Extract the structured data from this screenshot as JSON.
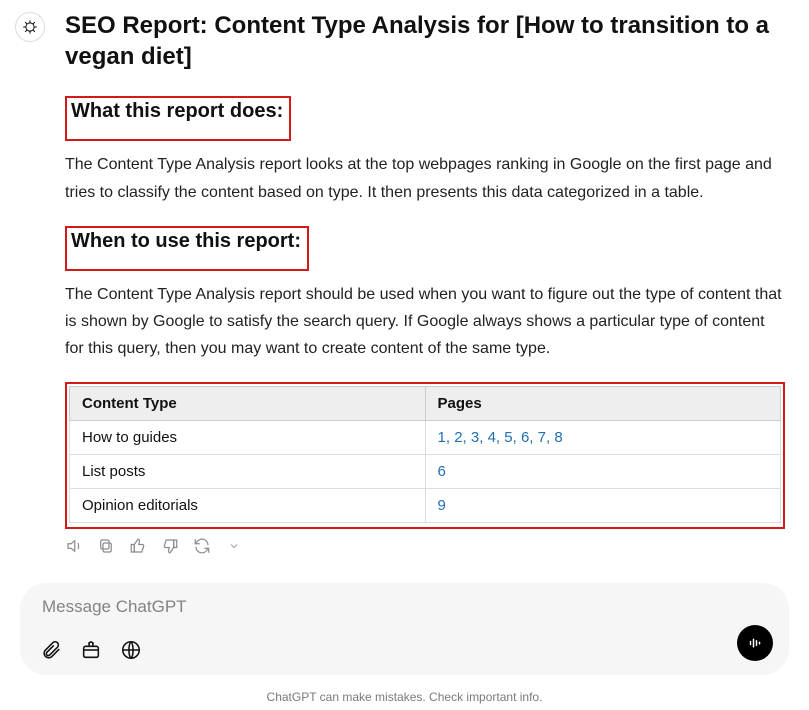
{
  "message": {
    "title": "SEO Report: Content Type Analysis for [How to transition to a vegan diet]",
    "section1_heading": "What this report does:",
    "section1_body": "The Content Type Analysis report looks at the top webpages ranking in Google on the first page and tries to classify the content based on type. It then presents this data categorized in a table.",
    "section2_heading": "When to use this report:",
    "section2_body": "The Content Type Analysis report should be used when you want to figure out the type of content that is shown by Google to satisfy the search query. If Google always shows a particular type of content for this query, then you may want to create content of the same type.",
    "table": {
      "headers": {
        "col1": "Content Type",
        "col2": "Pages"
      },
      "rows": [
        {
          "type": "How to guides",
          "pages": [
            "1",
            "2",
            "3",
            "4",
            "5",
            "6",
            "7",
            "8"
          ]
        },
        {
          "type": "List posts",
          "pages": [
            "6"
          ]
        },
        {
          "type": "Opinion editorials",
          "pages": [
            "9"
          ]
        }
      ]
    }
  },
  "composer": {
    "placeholder": "Message ChatGPT"
  },
  "footer": {
    "text": "ChatGPT can make mistakes. Check important info."
  }
}
